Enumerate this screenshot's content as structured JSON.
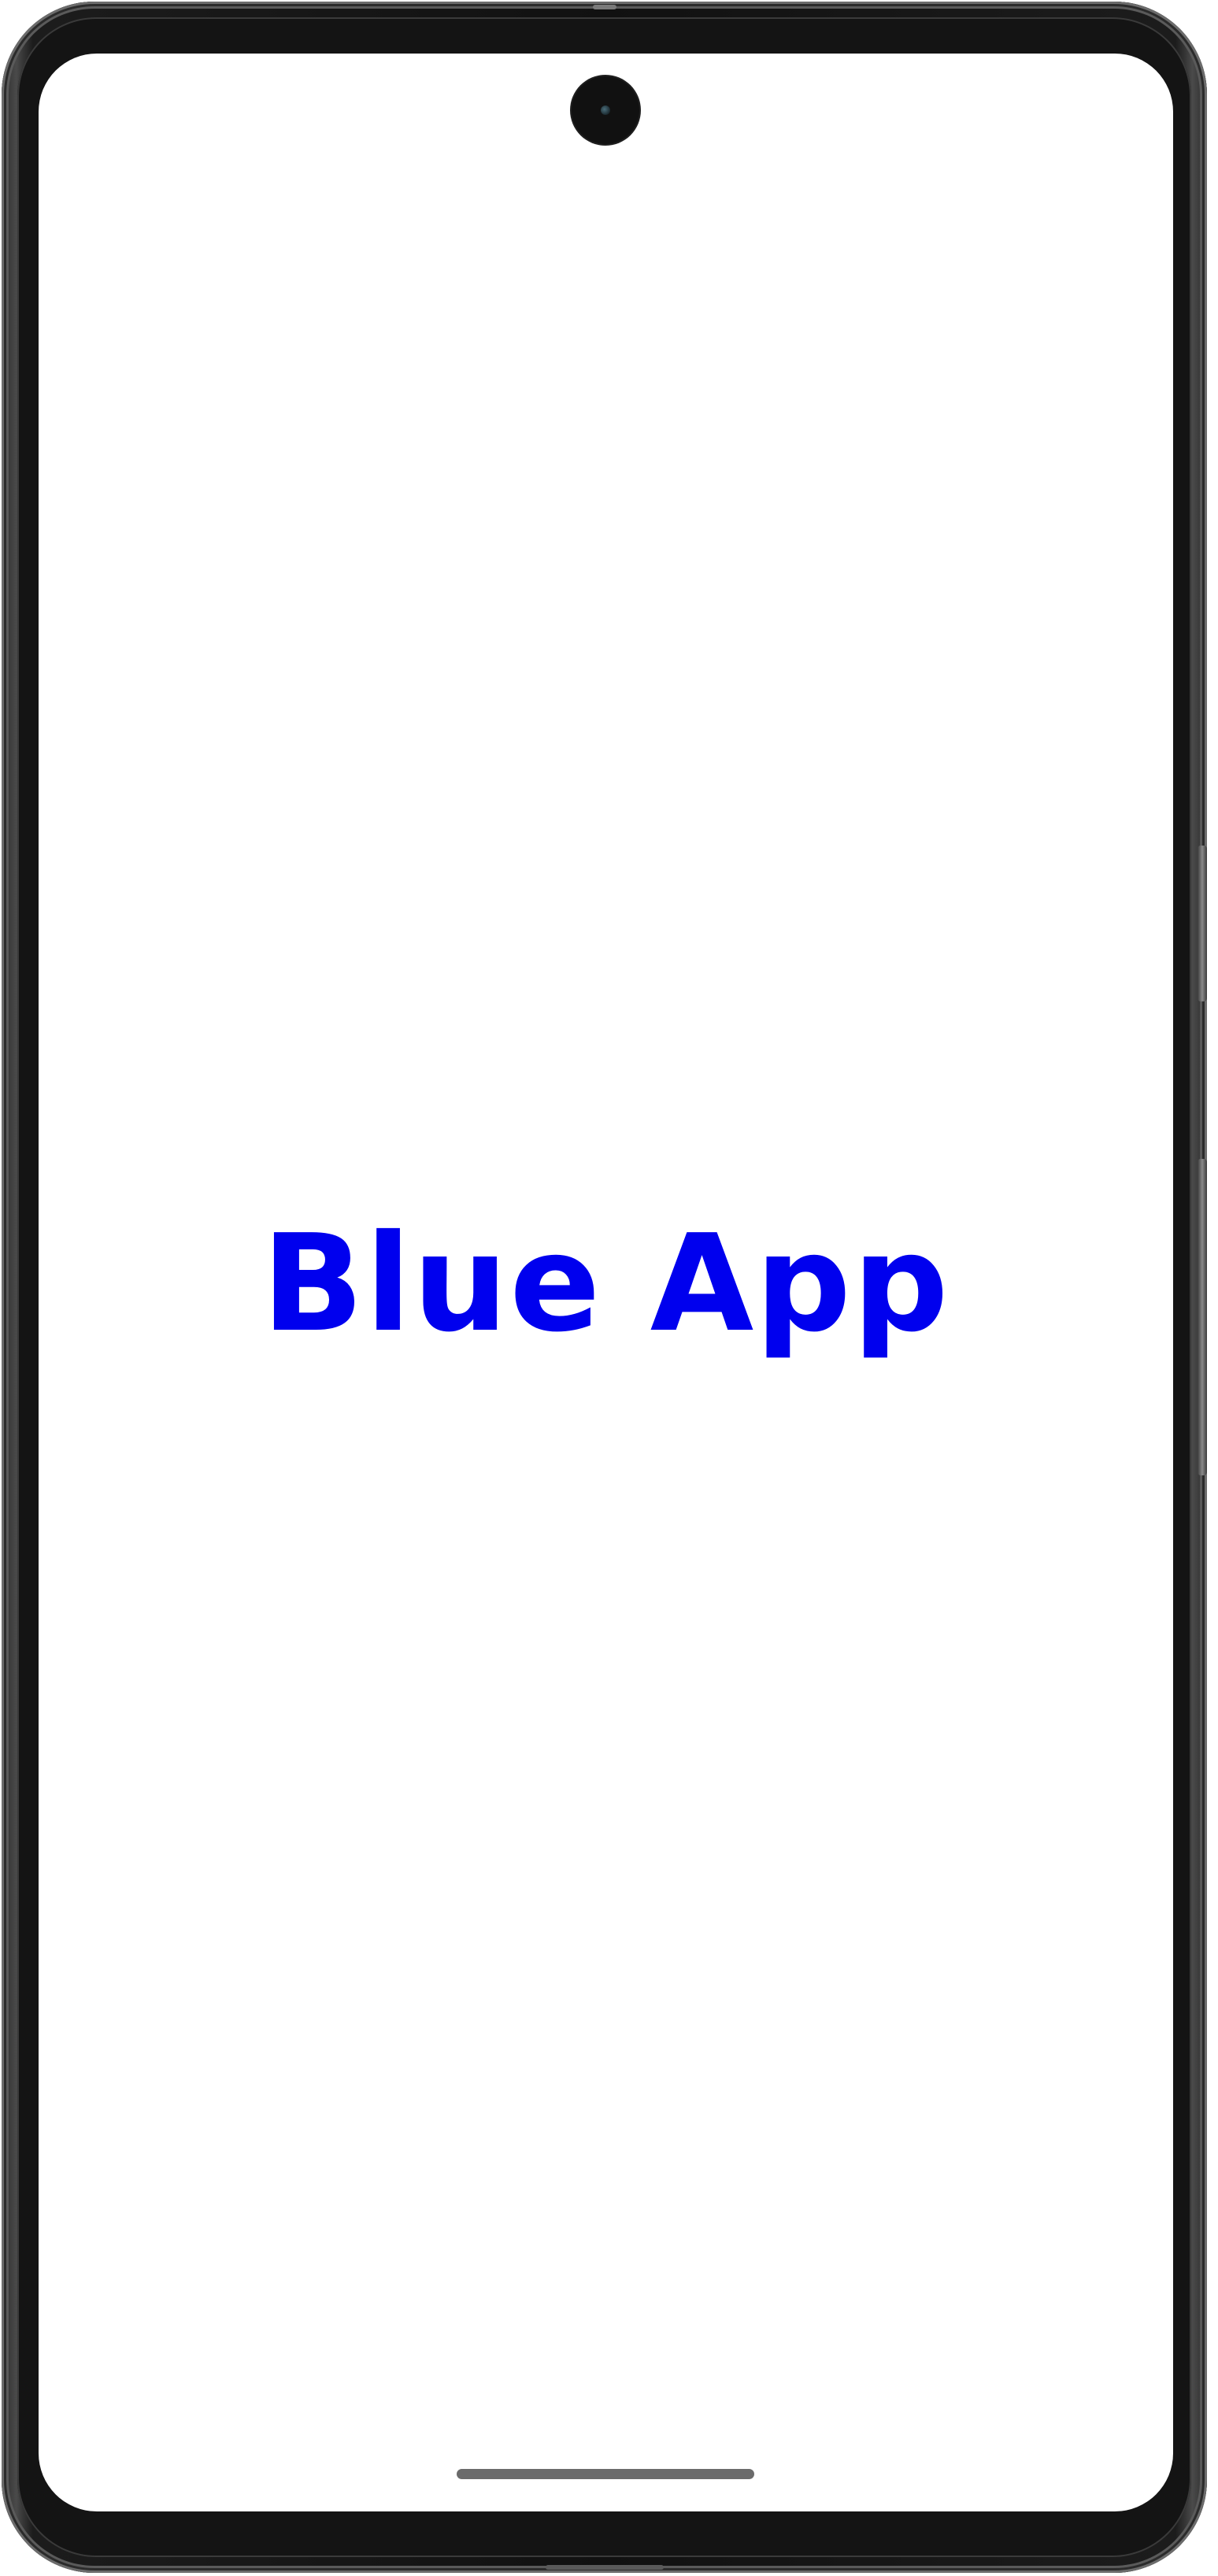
{
  "app": {
    "title": "Blue App",
    "title_color": "#0000EE"
  },
  "device": {
    "icons": {
      "camera": "front-camera-icon",
      "home_indicator": "home-indicator-bar"
    }
  }
}
